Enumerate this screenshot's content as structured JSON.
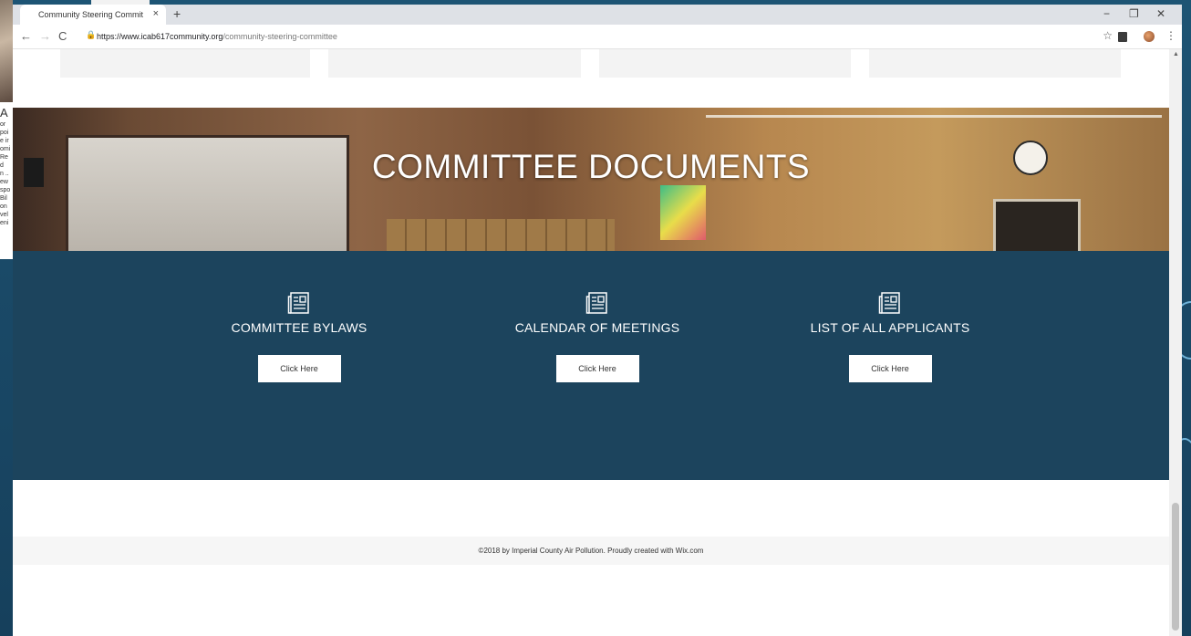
{
  "browser": {
    "tab_title": "Community Steering Committee",
    "tab_close": "×",
    "new_tab": "+",
    "url_host": "https://www.icab617community.org",
    "url_path": "/community-steering-committee",
    "minimize": "−",
    "restore": "❐",
    "close": "✕"
  },
  "page": {
    "banner_title": "COMMITTEE DOCUMENTS",
    "documents": [
      {
        "label": "COMMITTEE BYLAWS",
        "button": "Click Here"
      },
      {
        "label": "CALENDAR OF MEETINGS",
        "button": "Click Here"
      },
      {
        "label": "LIST OF ALL APPLICANTS",
        "button": "Click Here"
      }
    ],
    "footer": "©2018 by Imperial County Air Pollution. Proudly created with Wix.com"
  },
  "background_slide": {
    "heading_letter": "A",
    "text_lines": [
      "or",
      "poi",
      "e ir",
      "omi",
      "Re",
      "d",
      "n ..",
      "ew",
      "spo",
      "Bil",
      "on",
      "vel",
      "eni"
    ]
  },
  "colors": {
    "doc_section_bg": "#1c445d",
    "slide_bg": "#1d5474"
  }
}
